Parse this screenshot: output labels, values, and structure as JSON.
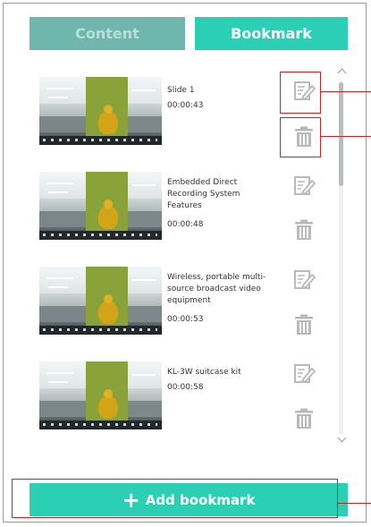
{
  "tabs": {
    "content_label": "Content",
    "bookmark_label": "Bookmark"
  },
  "bookmarks": [
    {
      "title": "Slide 1",
      "time": "00:00:43"
    },
    {
      "title": "Embedded Direct\nRecording System\nFeatures",
      "time": "00:00:48"
    },
    {
      "title": "Wireless, portable multi-\nsource broadcast video\nequipment",
      "time": "00:00:53"
    },
    {
      "title": "KL-3W suitcase kit",
      "time": "00:00:58"
    }
  ],
  "add_button": {
    "plus": "+",
    "label": "Add bookmark"
  },
  "colors": {
    "accent": "#2bd0b4",
    "inactive_tab": "#6fb7ad",
    "highlight": "#d02020",
    "icon": "#b9b9b9"
  },
  "icons": {
    "edit": "edit-icon",
    "delete": "trash-icon"
  }
}
